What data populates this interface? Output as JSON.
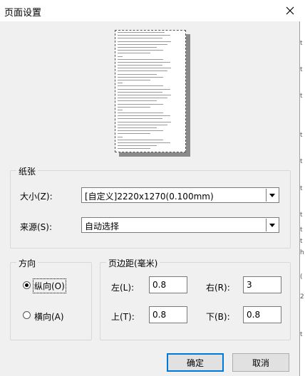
{
  "window": {
    "title": "页面设置"
  },
  "preview": {},
  "paper": {
    "legend": "纸张",
    "size_label": "大小(Z):",
    "size_value": "[自定义]2220x1270(0.100mm)",
    "source_label": "来源(S):",
    "source_value": "自动选择"
  },
  "orientation": {
    "legend": "方向",
    "portrait_label": "纵向(O)",
    "landscape_label": "横向(A)",
    "selected": "portrait"
  },
  "margins": {
    "legend": "页边距(毫米)",
    "left_label": "左(L):",
    "left_value": "0.8",
    "right_label": "右(R):",
    "right_value": "3",
    "top_label": "上(T):",
    "top_value": "0.8",
    "bottom_label": "下(B):",
    "bottom_value": "0.8"
  },
  "buttons": {
    "ok": "确定",
    "cancel": "取消"
  },
  "background_glyphs": [
    "t",
    "t",
    "t",
    "t",
    "t",
    "t",
    "t",
    "t",
    "t",
    "h",
    "(",
    "2",
    "t"
  ]
}
